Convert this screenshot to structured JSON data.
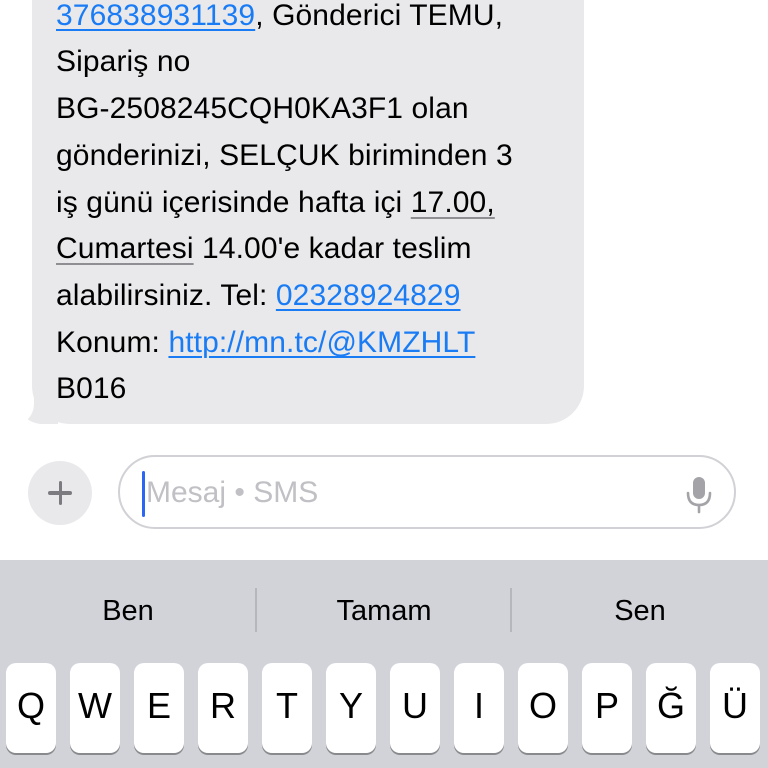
{
  "message": {
    "line1_link": "376838931139",
    "line1_rest": ", Gönderici TEMU,",
    "line2": "Sipariş no",
    "line3": "BG-2508245CQH0KA3F1 olan",
    "line4": "gönderinizi, SELÇUK biriminden 3",
    "line5_pre": "iş günü içerisinde hafta içi ",
    "line5_time": "17.00,",
    "line6_day": "Cumartesi",
    "line6_rest": " 14.00'e kadar teslim",
    "line7_pre": "alabilirsiniz. Tel: ",
    "line7_phone": "02328924829",
    "line8_pre": "Konum: ",
    "line8_link": "http://mn.tc/@KMZHLT",
    "line9": "B016"
  },
  "compose": {
    "placeholder": "Mesaj • SMS",
    "plus_icon": "plus-icon",
    "mic_icon": "microphone-icon"
  },
  "keyboard": {
    "suggestions": [
      "Ben",
      "Tamam",
      "Sen"
    ],
    "keys": [
      "Q",
      "W",
      "E",
      "R",
      "T",
      "Y",
      "U",
      "I",
      "O",
      "P",
      "Ğ",
      "Ü"
    ]
  },
  "colors": {
    "link": "#1a7cf5",
    "bubble": "#e9e9eb",
    "caret": "#2c66f5",
    "keyboard_bg": "#d1d3d9"
  }
}
